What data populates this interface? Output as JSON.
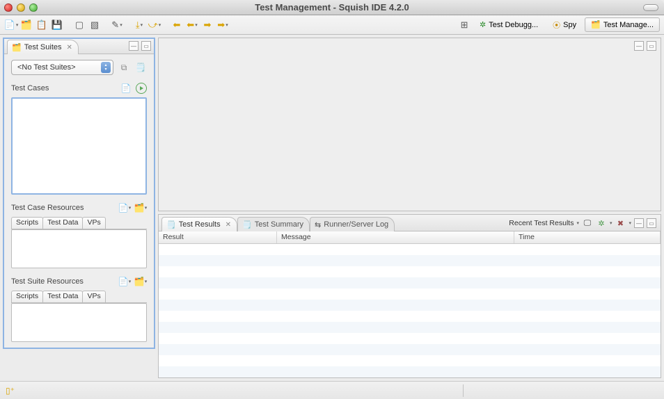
{
  "window": {
    "title": "Test Management - Squish IDE 4.2.0"
  },
  "toolbar": {
    "icons": [
      "file-new",
      "file-new-suite",
      "file-open",
      "save",
      "bookmark",
      "bookmark-add",
      "edit-pen",
      "step-into",
      "step-over",
      "step-out",
      "back",
      "back-history",
      "forward",
      "forward-history"
    ]
  },
  "perspectives": {
    "switcher_icon": "open-perspective",
    "items": [
      {
        "label": "Test Debugg...",
        "active": false,
        "icon": "bug-icon"
      },
      {
        "label": "Spy",
        "active": false,
        "icon": "spy-icon"
      },
      {
        "label": "Test Manage...",
        "active": true,
        "icon": "folder-icon"
      }
    ]
  },
  "left_view": {
    "tab_label": "Test Suites",
    "suite_select": "<No Test Suites>",
    "test_cases_label": "Test Cases",
    "case_resources_label": "Test Case Resources",
    "suite_resources_label": "Test Suite Resources",
    "resource_tabs": [
      "Scripts",
      "Test Data",
      "VPs"
    ]
  },
  "bottom_tabs": {
    "items": [
      {
        "label": "Test Results",
        "active": true
      },
      {
        "label": "Test Summary",
        "active": false
      },
      {
        "label": "Runner/Server Log",
        "active": false
      }
    ],
    "recent_label": "Recent Test Results",
    "columns": [
      "Result",
      "Message",
      "Time"
    ]
  }
}
